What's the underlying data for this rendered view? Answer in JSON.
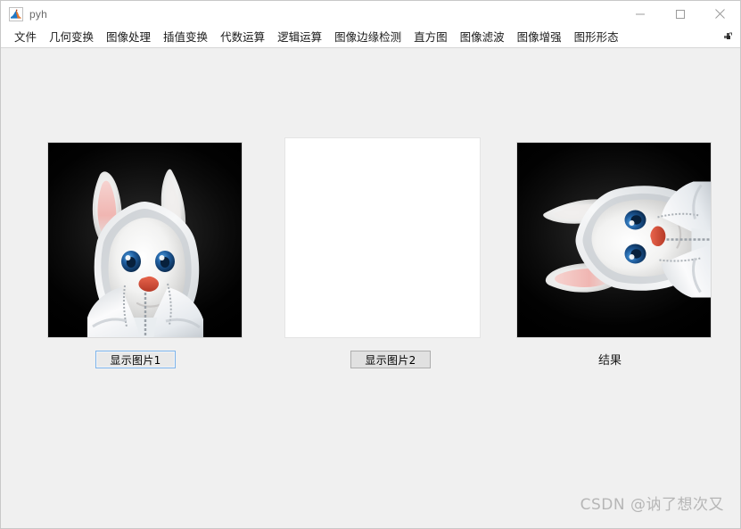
{
  "window": {
    "title": "pyh",
    "app_icon": "matlab-icon",
    "controls": {
      "minimize": "minimize-icon",
      "maximize": "maximize-icon",
      "close": "close-icon"
    },
    "background_color": "#f0f0f0",
    "titlebar_color": "#ffffff"
  },
  "menubar": {
    "items": [
      {
        "label": "文件"
      },
      {
        "label": "几何变换"
      },
      {
        "label": "图像处理"
      },
      {
        "label": "插值变换"
      },
      {
        "label": "代数运算"
      },
      {
        "label": "逻辑运算"
      },
      {
        "label": "图像边缘检测"
      },
      {
        "label": "直方图"
      },
      {
        "label": "图像滤波"
      },
      {
        "label": "图像增强"
      },
      {
        "label": "图形形态"
      }
    ],
    "overflow_icon": "menu-overflow-icon"
  },
  "panels": {
    "left": {
      "image_alt": "white-rabbit-in-hooded-jacket-dark-background",
      "button_label": "显示图片1",
      "button_focused": true
    },
    "middle": {
      "image_alt": "blank-white-canvas",
      "button_label": "显示图片2",
      "button_focused": false
    },
    "right": {
      "image_alt": "white-rabbit-rotated-90-degrees-counterclockwise",
      "caption": "结果"
    }
  },
  "watermark": {
    "text": "CSDN @讷了想次又"
  },
  "colors": {
    "focus_border": "#7eb4ea",
    "button_face": "#e1e1e1",
    "button_border": "#adadad",
    "client_bg": "#f0f0f0",
    "text": "#1a1a1a"
  }
}
